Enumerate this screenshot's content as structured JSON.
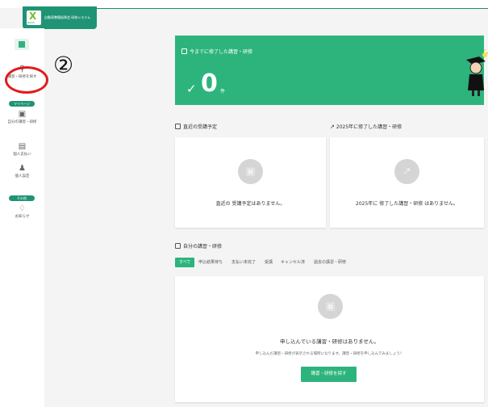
{
  "header": {
    "app_title": "自動車整備振興会 研修システム",
    "logo_mark": "X",
    "logo_sub": "NAVIS"
  },
  "sidebar": {
    "items": [
      {
        "label": "講習・研修を探す",
        "icon": "search-icon"
      },
      {
        "label": "自分の講習・研修",
        "icon": "bookmark-icon"
      },
      {
        "label": "個人支払い",
        "icon": "credit-card-icon"
      },
      {
        "label": "個人設定",
        "icon": "user-icon"
      },
      {
        "label": "お知らせ",
        "icon": "bell-icon"
      }
    ],
    "section_mypage": "マイページ",
    "section_other": "その他"
  },
  "annotation": {
    "step": "②",
    "highlight_color": "#e21b1b"
  },
  "hero": {
    "title": "今までに修了した講習・研修",
    "count": "0",
    "unit": "件"
  },
  "upcoming": {
    "title": "直近の受講予定",
    "empty_text": "直近の 受講予定はありません。"
  },
  "completed": {
    "title": "2025年に修了した講習・研修",
    "empty_text": "2025年に 修了した講習・研修 はありません。"
  },
  "my_courses": {
    "title": "自分の講習・研修",
    "tabs": [
      "すべて",
      "申込結果待ち",
      "支払い未完了",
      "受講",
      "キャンセル済",
      "過去の講習・研修"
    ],
    "empty_title": "申し込んでいる講習・研修はありません。",
    "empty_sub": "申し込んだ講習・研修が表示される場所になります。講習・研修を申し込んでみましょう！",
    "cta_label": "講習・研修を探す"
  },
  "colors": {
    "brand": "#1f9474",
    "accent": "#2db47d"
  }
}
